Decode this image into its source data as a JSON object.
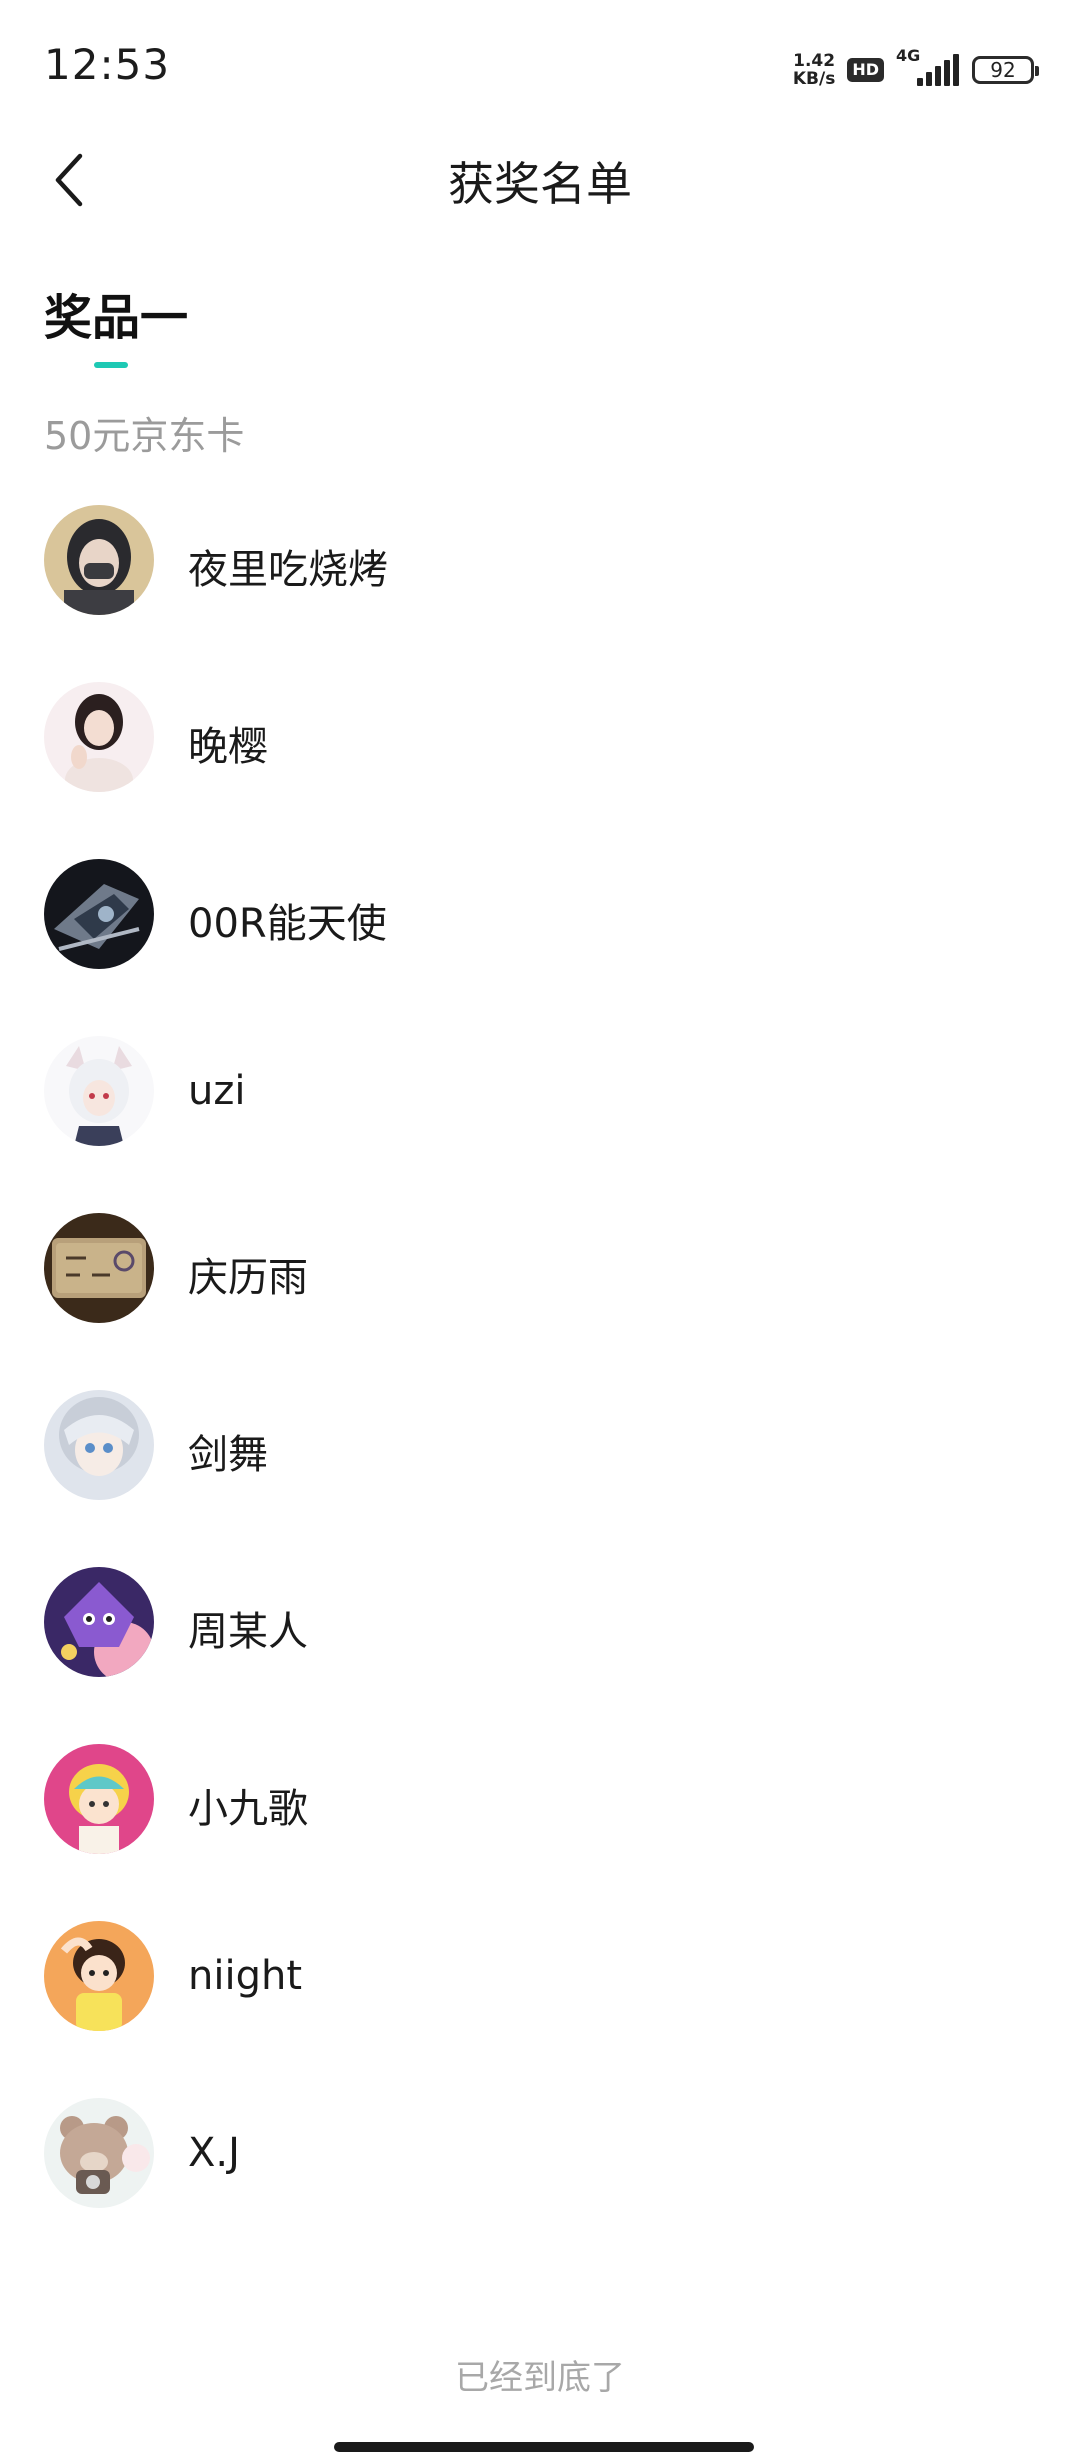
{
  "status_bar": {
    "time": "12:53",
    "net_speed_value": "1.42",
    "net_speed_unit": "KB/s",
    "hd_badge": "HD",
    "network_type": "4G",
    "battery_level": "92"
  },
  "header": {
    "title": "获奖名单",
    "back_icon": "chevron-left-icon"
  },
  "prize": {
    "tab_label": "奖品一",
    "description": "50元京东卡",
    "accent_color": "#1ec9b4"
  },
  "winners": [
    {
      "name": "夜里吃烧烤"
    },
    {
      "name": "晚樱"
    },
    {
      "name": "00R能天使"
    },
    {
      "name": "uzi"
    },
    {
      "name": "庆历雨"
    },
    {
      "name": "剑舞"
    },
    {
      "name": "周某人"
    },
    {
      "name": "小九歌"
    },
    {
      "name": "niight"
    },
    {
      "name": "X.J"
    }
  ],
  "footer": {
    "end_text": "已经到底了"
  }
}
